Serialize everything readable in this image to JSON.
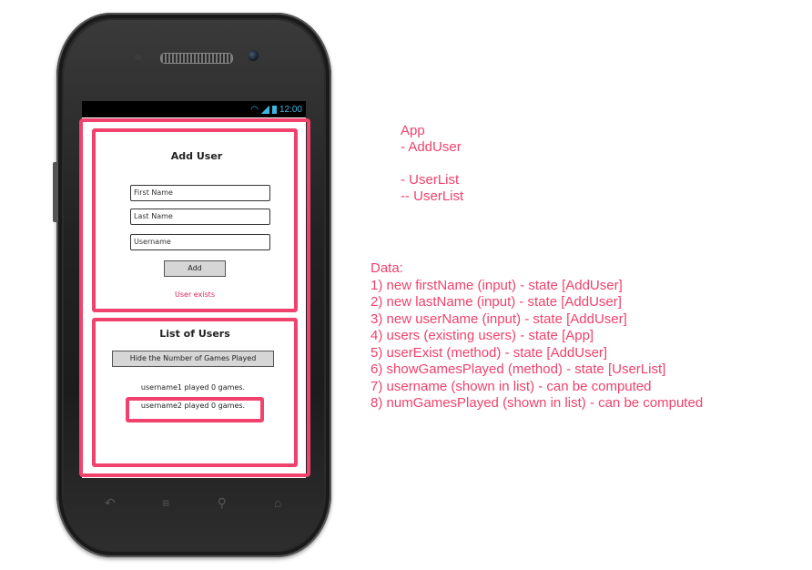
{
  "phone": {
    "status_time": "12:00",
    "add_user": {
      "heading": "Add User",
      "first_name_placeholder": "First Name",
      "last_name_placeholder": "Last Name",
      "username_placeholder": "Username",
      "add_button": "Add",
      "error": "User exists"
    },
    "user_list": {
      "heading": "List of Users",
      "toggle_button": "Hide the Number of Games Played",
      "users": [
        "username1 played 0 games.",
        "username2 played 0 games."
      ]
    },
    "nav_icons": [
      "back-icon",
      "menu-icon",
      "search-icon",
      "home-icon"
    ]
  },
  "annotations": {
    "hierarchy": [
      "App",
      "- AddUser",
      "",
      "- UserList",
      "-- UserList"
    ],
    "data_title": "Data:",
    "data_items": [
      "1) new firstName (input) - state [AddUser]",
      "2) new lastName (input) - state [AddUser]",
      "3) new userName (input) - state [AddUser]",
      "4) users (existing users) - state [App]",
      "5) userExist (method) - state [AddUser]",
      "6) showGamesPlayed (method) - state [UserList]",
      "7) username (shown in list) - can be computed",
      "8) numGamesPlayed (shown in list) - can be computed"
    ],
    "accent_color": "#f0426c"
  }
}
